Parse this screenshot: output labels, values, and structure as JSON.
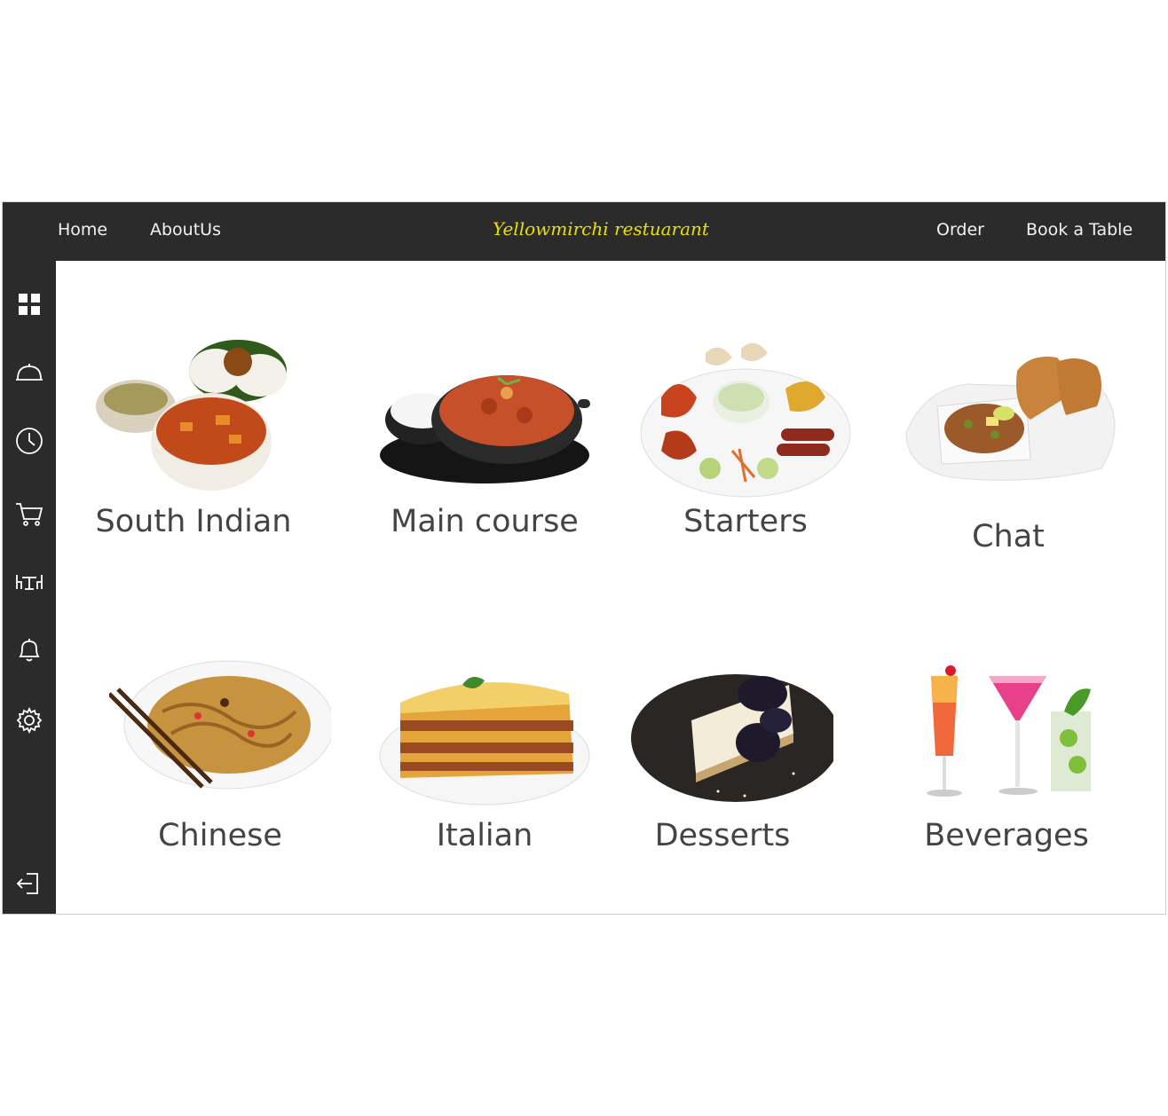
{
  "topbar": {
    "left_links": [
      "Home",
      "AboutUs"
    ],
    "brand": "Yellowmirchi restuarant",
    "right_links": [
      "Order",
      "Book a Table"
    ]
  },
  "sidebar": {
    "icons": [
      "dashboard-grid-icon",
      "cloche-menu-icon",
      "clock-icon",
      "cart-icon",
      "dining-table-icon",
      "bell-icon",
      "gear-icon"
    ],
    "bottom_icon": "logout-icon"
  },
  "colors": {
    "bar": "#2b2b2b",
    "brand_text": "#e8e000",
    "label": "#444444"
  },
  "categories": [
    {
      "label": "South Indian",
      "image": "south-indian-dish"
    },
    {
      "label": "Main course",
      "image": "curry-with-rice"
    },
    {
      "label": "Starters",
      "image": "tandoori-platter"
    },
    {
      "label": "Chat",
      "image": "pav-bhaji"
    },
    {
      "label": "Chinese",
      "image": "noodles-with-chopsticks"
    },
    {
      "label": "Italian",
      "image": "lasagna"
    },
    {
      "label": "Desserts",
      "image": "cheesecake"
    },
    {
      "label": "Beverages",
      "image": "cocktails"
    }
  ]
}
